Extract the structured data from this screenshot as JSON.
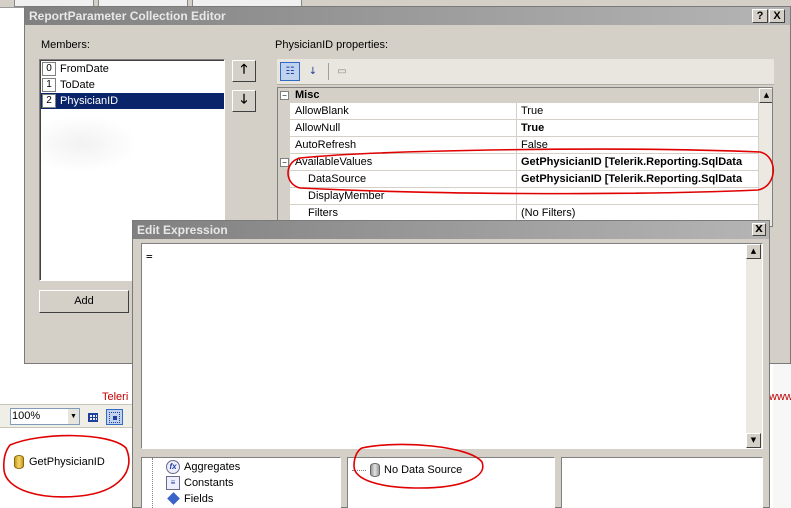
{
  "background": {
    "red_text_left": "Teleri",
    "red_text_right": "www",
    "zoom_value": "100%",
    "data_source_item": "GetPhysicianID"
  },
  "collection_editor": {
    "title": "ReportParameter Collection Editor",
    "help_button": "?",
    "close_button": "X",
    "members_label": "Members:",
    "members": [
      {
        "index": "0",
        "name": "FromDate"
      },
      {
        "index": "1",
        "name": "ToDate"
      },
      {
        "index": "2",
        "name": "PhysicianID",
        "selected": true
      }
    ],
    "move_up_icon": "arrow-up-icon",
    "move_down_icon": "arrow-down-icon",
    "add_button": "Add",
    "properties_label": "PhysicianID properties:",
    "toolbar": {
      "categorized_icon": "categorized-icon",
      "alphabetical_icon": "alphabetical-icon",
      "property_pages_icon": "property-pages-icon"
    },
    "property_grid": {
      "category": "Misc",
      "category_expander": "−",
      "rows": [
        {
          "name": "AllowBlank",
          "value": "True",
          "bold": false
        },
        {
          "name": "AllowNull",
          "value": "True",
          "bold": true
        },
        {
          "name": "AutoRefresh",
          "value": "False",
          "bold": false
        },
        {
          "name": "AvailableValues",
          "value": "GetPhysicianID [Telerik.Reporting.SqlData",
          "bold": true,
          "expander": "−"
        },
        {
          "name": "DataSource",
          "value": "GetPhysicianID [Telerik.Reporting.SqlData",
          "bold": true,
          "indent": true
        },
        {
          "name": "DisplayMember",
          "value": "",
          "bold": false,
          "indent": true
        },
        {
          "name": "Filters",
          "value": "(No Filters)",
          "bold": false,
          "indent": true
        }
      ]
    }
  },
  "edit_expression": {
    "title": "Edit Expression",
    "close_button": "X",
    "expression": "=",
    "tree": [
      {
        "label": "Aggregates",
        "icon": "function-icon"
      },
      {
        "label": "Constants",
        "icon": "constants-icon"
      },
      {
        "label": "Fields",
        "icon": "fields-icon"
      }
    ],
    "data_source_item": "No Data Source"
  },
  "colors": {
    "selection": "#0a246a",
    "annotation": "#e00000",
    "title_bar": "#808080",
    "dialog_face": "#d4d0c8"
  }
}
